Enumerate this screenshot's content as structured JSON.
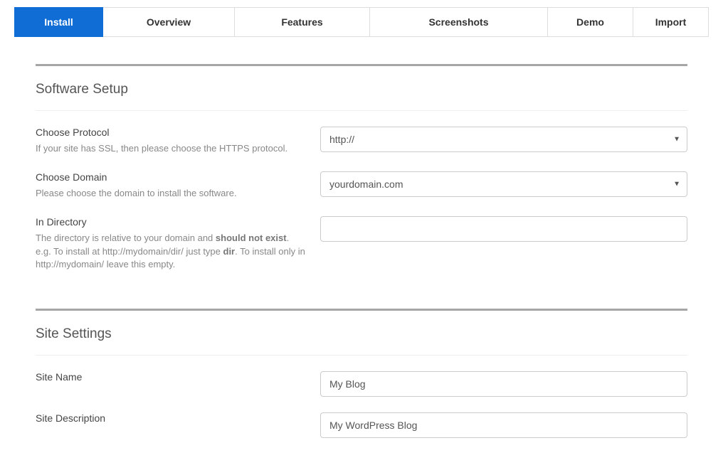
{
  "tabs": {
    "install": "Install",
    "overview": "Overview",
    "features": "Features",
    "screenshots": "Screenshots",
    "demo": "Demo",
    "import": "Import"
  },
  "sections": {
    "software_setup": {
      "title": "Software Setup",
      "choose_protocol": {
        "label": "Choose Protocol",
        "help": "If your site has SSL, then please choose the HTTPS protocol.",
        "value": "http://"
      },
      "choose_domain": {
        "label": "Choose Domain",
        "help": "Please choose the domain to install the software.",
        "value": "yourdomain.com"
      },
      "in_directory": {
        "label": "In Directory",
        "help_pre": "The directory is relative to your domain and ",
        "help_bold1": "should not exist",
        "help_mid": ". e.g. To install at http://mydomain/dir/ just type ",
        "help_bold2": "dir",
        "help_post": ". To install only in http://mydomain/ leave this empty.",
        "value": ""
      }
    },
    "site_settings": {
      "title": "Site Settings",
      "site_name": {
        "label": "Site Name",
        "value": "My Blog"
      },
      "site_description": {
        "label": "Site Description",
        "value": "My WordPress Blog"
      }
    }
  }
}
